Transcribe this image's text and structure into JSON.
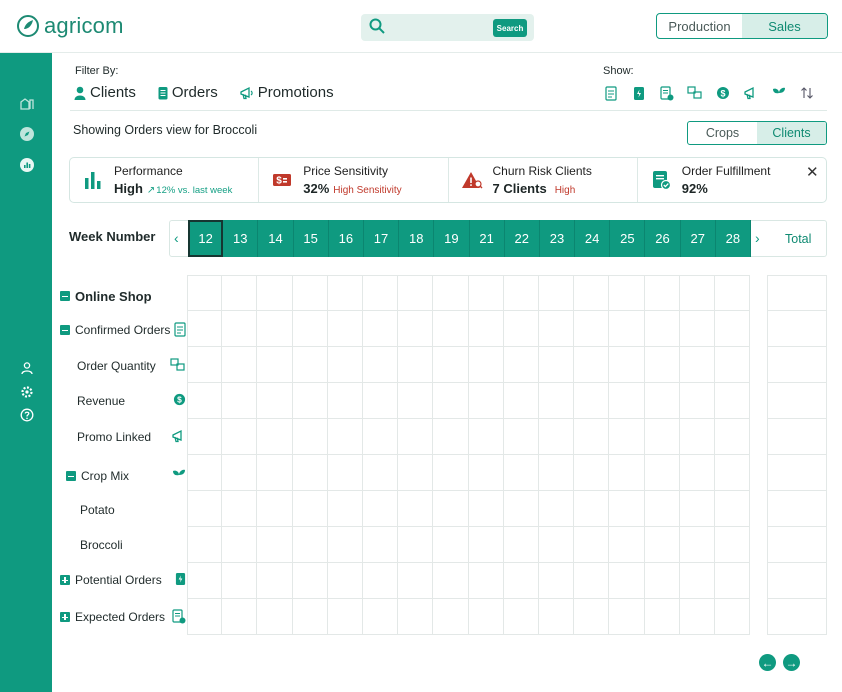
{
  "header": {
    "logo_text": "agricom",
    "search_button": "Search",
    "modes": [
      "Production",
      "Sales"
    ],
    "active_mode": "Sales"
  },
  "sidebar": {
    "top_icons": [
      "farm-icon",
      "compass-icon",
      "chart-icon"
    ],
    "bottom_icons": [
      "user-icon",
      "settings-icon",
      "help-icon"
    ]
  },
  "filter": {
    "label": "Filter By:",
    "items": [
      {
        "label": "Clients",
        "icon": "user-icon"
      },
      {
        "label": "Orders",
        "icon": "orders-icon"
      },
      {
        "label": "Promotions",
        "icon": "megaphone-icon"
      }
    ]
  },
  "show": {
    "label": "Show:",
    "icons": [
      "confirmed-orders-icon",
      "potential-orders-icon",
      "expected-orders-icon",
      "quantity-icon",
      "revenue-icon",
      "promo-icon",
      "crop-icon",
      "sort-icon"
    ]
  },
  "view": {
    "showing_text": "Showing Orders view for Broccoli",
    "toggle": [
      "Crops",
      "Clients"
    ],
    "active": "Clients"
  },
  "kpis": [
    {
      "title": "Performance",
      "value": "High",
      "sub": "12% vs. last week",
      "icon": "bar-chart-icon",
      "sub_color": "#16a085"
    },
    {
      "title": "Price Sensitivity",
      "value": "32%",
      "sub": "High Sensitivity",
      "icon": "price-tag-icon",
      "sub_color": "#c0392b"
    },
    {
      "title": "Churn Risk Clients",
      "value": "7 Clients",
      "sub": "High",
      "icon": "warning-icon",
      "sub_color": "#c0392b"
    },
    {
      "title": "Order Fulfillment",
      "value": "92%",
      "sub": "",
      "icon": "fulfillment-icon",
      "sub_color": ""
    }
  ],
  "weeks": {
    "label": "Week Number",
    "numbers": [
      "12",
      "13",
      "14",
      "15",
      "16",
      "17",
      "18",
      "19",
      "21",
      "22",
      "23",
      "24",
      "25",
      "26",
      "27",
      "28"
    ],
    "selected": "12",
    "total_label": "Total"
  },
  "tree": {
    "online_shop": "Online Shop",
    "confirmed_orders": "Confirmed Orders",
    "order_quantity": "Order Quantity",
    "revenue": "Revenue",
    "promo_linked": "Promo Linked",
    "crop_mix": "Crop Mix",
    "potato": "Potato",
    "broccoli": "Broccoli",
    "potential_orders": "Potential Orders",
    "expected_orders": "Expected Orders"
  }
}
